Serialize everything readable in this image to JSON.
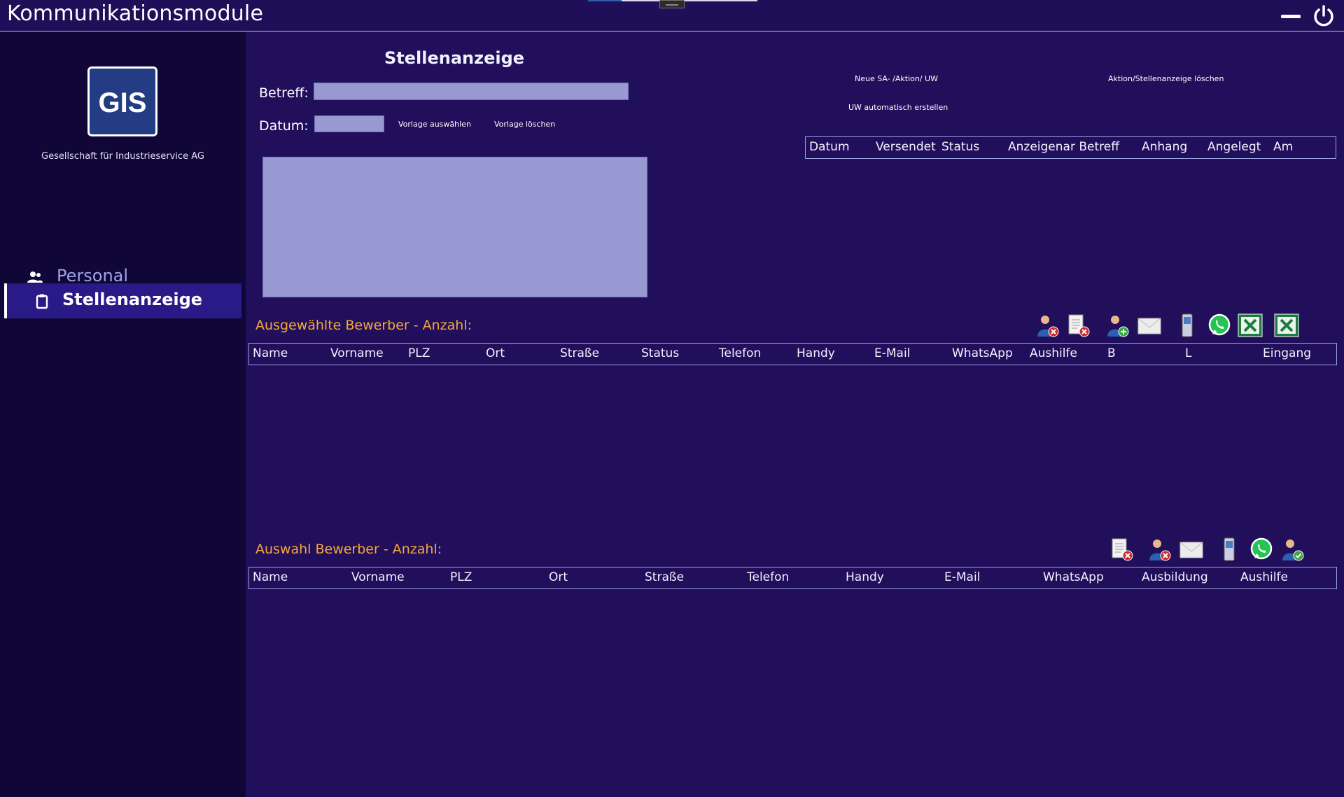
{
  "window": {
    "title": "Kommunikationsmodule"
  },
  "sidebar": {
    "logo_text": "GIS",
    "company_name": "Gesellschaft für Industrieservice AG",
    "items": [
      {
        "label": "Personal",
        "icon": "people-icon"
      },
      {
        "label": "Stellenanzeige",
        "icon": "clipboard-icon",
        "active": true
      }
    ]
  },
  "form": {
    "heading": "Stellenanzeige",
    "betreff_label": "Betreff:",
    "betreff_value": "",
    "datum_label": "Datum:",
    "datum_value": "",
    "body_value": "",
    "vorlage_auswaehlen": "Vorlage auswählen",
    "vorlage_loeschen": "Vorlage löschen"
  },
  "actions": {
    "neue_sa": "Neue SA- /Aktion/ UW",
    "aktion_loeschen": "Aktion/Stellenanzeige löschen",
    "uw_automatisch": "UW automatisch erstellen"
  },
  "sa_grid": {
    "columns": [
      "Datum",
      "Versendet",
      "Status",
      "Anzeigenar Betreff",
      "Anhang",
      "Angelegt",
      "Am"
    ]
  },
  "selected_applicants": {
    "title": "Ausgewählte Bewerber - Anzahl:",
    "columns": [
      "Name",
      "Vorname",
      "PLZ",
      "Ort",
      "Straße",
      "Status",
      "Telefon",
      "Handy",
      "E-Mail",
      "WhatsApp",
      "Aushilfe",
      "B",
      "L",
      "Eingang"
    ],
    "toolbar": [
      "remove-user-icon",
      "delete-document-icon",
      "add-user-icon",
      "email-icon",
      "mobile-phone-icon",
      "whatsapp-icon",
      "excel-icon",
      "excel-export-icon"
    ]
  },
  "applicant_pool": {
    "title": "Auswahl Bewerber - Anzahl:",
    "columns": [
      "Name",
      "Vorname",
      "PLZ",
      "Ort",
      "Straße",
      "Telefon",
      "Handy",
      "E-Mail",
      "WhatsApp",
      "Ausbildung",
      "Aushilfe"
    ],
    "toolbar": [
      "delete-document-icon",
      "remove-user-icon",
      "email-icon",
      "mobile-phone-icon",
      "whatsapp-icon",
      "confirm-user-icon"
    ]
  },
  "colors": {
    "background": "#220f5c",
    "sidebar": "#100638",
    "active_nav": "#2a1a87",
    "input": "#9898d2",
    "accent_heading": "#f4a93b",
    "grid_border": "#9aa2e2",
    "excel_green": "#1e7b3f",
    "whatsapp_green": "#25c354"
  }
}
